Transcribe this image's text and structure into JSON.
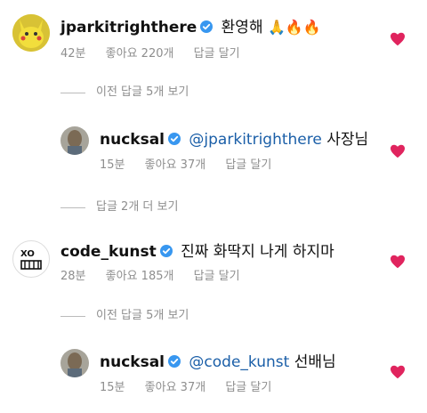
{
  "comments": [
    {
      "username": "jparkitrighthere",
      "text": "환영해",
      "emoji": "🙏🔥🔥",
      "time": "42분",
      "likes": "좋아요 220개",
      "reply": "답글 달기"
    },
    {
      "view_more": "이전 답글 5개 보기"
    },
    {
      "username": "nucksal",
      "mention": "@jparkitrighthere",
      "text": "사장님",
      "time": "15분",
      "likes": "좋아요 37개",
      "reply": "답글 달기"
    },
    {
      "view_more": "답글 2개 더 보기"
    },
    {
      "username": "code_kunst",
      "text": "진짜 화딱지 나게 하지마",
      "time": "28분",
      "likes": "좋아요 185개",
      "reply": "답글 달기"
    },
    {
      "view_more": "이전 답글 5개 보기"
    },
    {
      "username": "nucksal",
      "mention": "@code_kunst",
      "text": "선배님",
      "time": "15분",
      "likes": "좋아요 37개",
      "reply": "답글 달기"
    }
  ],
  "colors": {
    "verified": "#3897f0",
    "heart": "#e0245e",
    "mention": "#1b5fa8",
    "muted": "#8e8e8e"
  },
  "icons": [
    "verified-badge-icon",
    "heart-icon"
  ]
}
